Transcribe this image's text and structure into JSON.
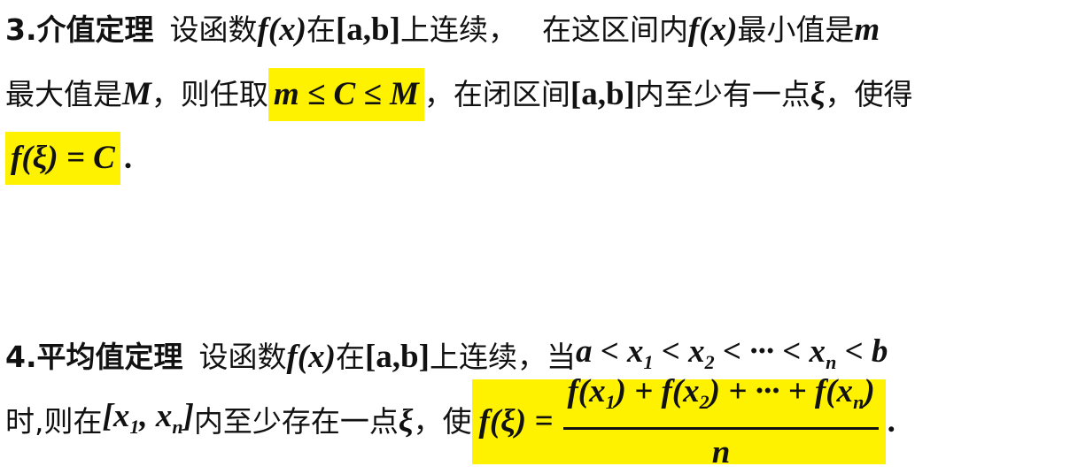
{
  "section3": {
    "title": "3.介值定理",
    "line1": {
      "t1": "设函数",
      "fx": "f(x)",
      "t2": "在",
      "interval": "[a,b]",
      "t3": "上连续，",
      "t4": "在这区间内",
      "fx2": "f(x)",
      "t5": "最小值是",
      "m": "m"
    },
    "line2": {
      "t1": "最大值是",
      "M": "M",
      "t2": "，则任取",
      "condition": "m ≤ C ≤ M",
      "t3": "，在闭区间",
      "interval": "[a,b]",
      "t4": "内至少有一点",
      "xi": "ξ",
      "t5": "，使得"
    },
    "line3": {
      "result": "f(ξ) = C",
      "end": "."
    }
  },
  "section4": {
    "title": "4.平均值定理",
    "line1": {
      "t1": "设函数",
      "fx": "f(x)",
      "t2": "在",
      "interval": "[a,b]",
      "t3": "上连续，当",
      "a": "a < x",
      "s1": "1",
      "lt1": " < x",
      "s2": "2",
      "lt2": " < ··· < x",
      "sn": "n",
      "lt3": " < b"
    },
    "line2": {
      "t1": "时,则在",
      "lb": "[x",
      "s1": "1",
      "comma": ", x",
      "sn": "n",
      "rb": "]",
      "t2": "内至少存在一点",
      "xi": "ξ",
      "t3": "，使",
      "lhs": "f(ξ) =",
      "num_a": "f(x",
      "num_s1": "1",
      "num_b": ") + f(x",
      "num_s2": "2",
      "num_c": ") + ··· + f(x",
      "num_sn": "n",
      "num_d": ")",
      "den": "n",
      "end": "."
    }
  }
}
